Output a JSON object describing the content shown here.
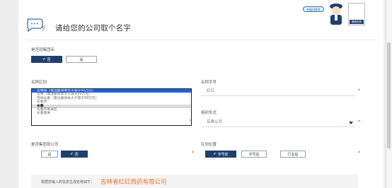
{
  "header": {
    "title": "请给您的公司取个名字",
    "help_button": "有疑问联系",
    "bubble_label": "看看范例",
    "icon": "question-chat-icon"
  },
  "is_group": {
    "label": "是否冠集团名",
    "options": [
      "否",
      "是"
    ],
    "selected": "否"
  },
  "region": {
    "label": "名称区划",
    "options": [
      "吉林省（需注册资本大于等于50万元）",
      "吉林（需注册资本大于等于50万元）",
      "吉林长春（需注册资本大于等于50万元）",
      "长春市",
      "长春",
      "长春市南关区",
      "长春南关"
    ],
    "selected_index": 0,
    "highlighted_index": 4
  },
  "name_field": {
    "label": "名称字号",
    "value": "红红"
  },
  "org_form": {
    "label": "组织形式",
    "value": "有限公司"
  },
  "parent_company": {
    "label": "是否集团母公司",
    "options": [
      "是",
      "否"
    ],
    "selected": "否"
  },
  "position": {
    "label": "区划位置",
    "options": [
      "字号前",
      "字号后",
      "行业后"
    ],
    "selected": "字号前"
  },
  "result": {
    "prefix": "根据您输入的信息生成名称如下：",
    "name": "吉林省红红西药有限公司"
  },
  "colors": {
    "accent": "#1f3f6e",
    "highlight": "#1f63d8",
    "orange": "#e7732b",
    "required": "#e33333"
  }
}
